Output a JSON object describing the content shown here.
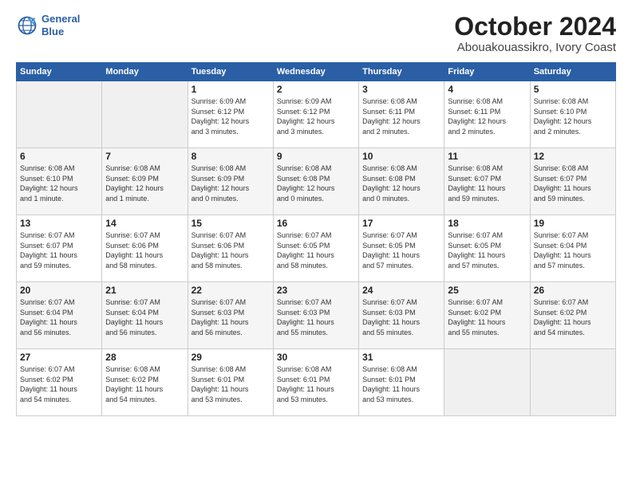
{
  "logo": {
    "line1": "General",
    "line2": "Blue"
  },
  "title": "October 2024",
  "location": "Abouakouassikro, Ivory Coast",
  "days_of_week": [
    "Sunday",
    "Monday",
    "Tuesday",
    "Wednesday",
    "Thursday",
    "Friday",
    "Saturday"
  ],
  "weeks": [
    [
      {
        "day": "",
        "info": ""
      },
      {
        "day": "",
        "info": ""
      },
      {
        "day": "1",
        "info": "Sunrise: 6:09 AM\nSunset: 6:12 PM\nDaylight: 12 hours\nand 3 minutes."
      },
      {
        "day": "2",
        "info": "Sunrise: 6:09 AM\nSunset: 6:12 PM\nDaylight: 12 hours\nand 3 minutes."
      },
      {
        "day": "3",
        "info": "Sunrise: 6:08 AM\nSunset: 6:11 PM\nDaylight: 12 hours\nand 2 minutes."
      },
      {
        "day": "4",
        "info": "Sunrise: 6:08 AM\nSunset: 6:11 PM\nDaylight: 12 hours\nand 2 minutes."
      },
      {
        "day": "5",
        "info": "Sunrise: 6:08 AM\nSunset: 6:10 PM\nDaylight: 12 hours\nand 2 minutes."
      }
    ],
    [
      {
        "day": "6",
        "info": "Sunrise: 6:08 AM\nSunset: 6:10 PM\nDaylight: 12 hours\nand 1 minute."
      },
      {
        "day": "7",
        "info": "Sunrise: 6:08 AM\nSunset: 6:09 PM\nDaylight: 12 hours\nand 1 minute."
      },
      {
        "day": "8",
        "info": "Sunrise: 6:08 AM\nSunset: 6:09 PM\nDaylight: 12 hours\nand 0 minutes."
      },
      {
        "day": "9",
        "info": "Sunrise: 6:08 AM\nSunset: 6:08 PM\nDaylight: 12 hours\nand 0 minutes."
      },
      {
        "day": "10",
        "info": "Sunrise: 6:08 AM\nSunset: 6:08 PM\nDaylight: 12 hours\nand 0 minutes."
      },
      {
        "day": "11",
        "info": "Sunrise: 6:08 AM\nSunset: 6:07 PM\nDaylight: 11 hours\nand 59 minutes."
      },
      {
        "day": "12",
        "info": "Sunrise: 6:08 AM\nSunset: 6:07 PM\nDaylight: 11 hours\nand 59 minutes."
      }
    ],
    [
      {
        "day": "13",
        "info": "Sunrise: 6:07 AM\nSunset: 6:07 PM\nDaylight: 11 hours\nand 59 minutes."
      },
      {
        "day": "14",
        "info": "Sunrise: 6:07 AM\nSunset: 6:06 PM\nDaylight: 11 hours\nand 58 minutes."
      },
      {
        "day": "15",
        "info": "Sunrise: 6:07 AM\nSunset: 6:06 PM\nDaylight: 11 hours\nand 58 minutes."
      },
      {
        "day": "16",
        "info": "Sunrise: 6:07 AM\nSunset: 6:05 PM\nDaylight: 11 hours\nand 58 minutes."
      },
      {
        "day": "17",
        "info": "Sunrise: 6:07 AM\nSunset: 6:05 PM\nDaylight: 11 hours\nand 57 minutes."
      },
      {
        "day": "18",
        "info": "Sunrise: 6:07 AM\nSunset: 6:05 PM\nDaylight: 11 hours\nand 57 minutes."
      },
      {
        "day": "19",
        "info": "Sunrise: 6:07 AM\nSunset: 6:04 PM\nDaylight: 11 hours\nand 57 minutes."
      }
    ],
    [
      {
        "day": "20",
        "info": "Sunrise: 6:07 AM\nSunset: 6:04 PM\nDaylight: 11 hours\nand 56 minutes."
      },
      {
        "day": "21",
        "info": "Sunrise: 6:07 AM\nSunset: 6:04 PM\nDaylight: 11 hours\nand 56 minutes."
      },
      {
        "day": "22",
        "info": "Sunrise: 6:07 AM\nSunset: 6:03 PM\nDaylight: 11 hours\nand 56 minutes."
      },
      {
        "day": "23",
        "info": "Sunrise: 6:07 AM\nSunset: 6:03 PM\nDaylight: 11 hours\nand 55 minutes."
      },
      {
        "day": "24",
        "info": "Sunrise: 6:07 AM\nSunset: 6:03 PM\nDaylight: 11 hours\nand 55 minutes."
      },
      {
        "day": "25",
        "info": "Sunrise: 6:07 AM\nSunset: 6:02 PM\nDaylight: 11 hours\nand 55 minutes."
      },
      {
        "day": "26",
        "info": "Sunrise: 6:07 AM\nSunset: 6:02 PM\nDaylight: 11 hours\nand 54 minutes."
      }
    ],
    [
      {
        "day": "27",
        "info": "Sunrise: 6:07 AM\nSunset: 6:02 PM\nDaylight: 11 hours\nand 54 minutes."
      },
      {
        "day": "28",
        "info": "Sunrise: 6:08 AM\nSunset: 6:02 PM\nDaylight: 11 hours\nand 54 minutes."
      },
      {
        "day": "29",
        "info": "Sunrise: 6:08 AM\nSunset: 6:01 PM\nDaylight: 11 hours\nand 53 minutes."
      },
      {
        "day": "30",
        "info": "Sunrise: 6:08 AM\nSunset: 6:01 PM\nDaylight: 11 hours\nand 53 minutes."
      },
      {
        "day": "31",
        "info": "Sunrise: 6:08 AM\nSunset: 6:01 PM\nDaylight: 11 hours\nand 53 minutes."
      },
      {
        "day": "",
        "info": ""
      },
      {
        "day": "",
        "info": ""
      }
    ]
  ]
}
